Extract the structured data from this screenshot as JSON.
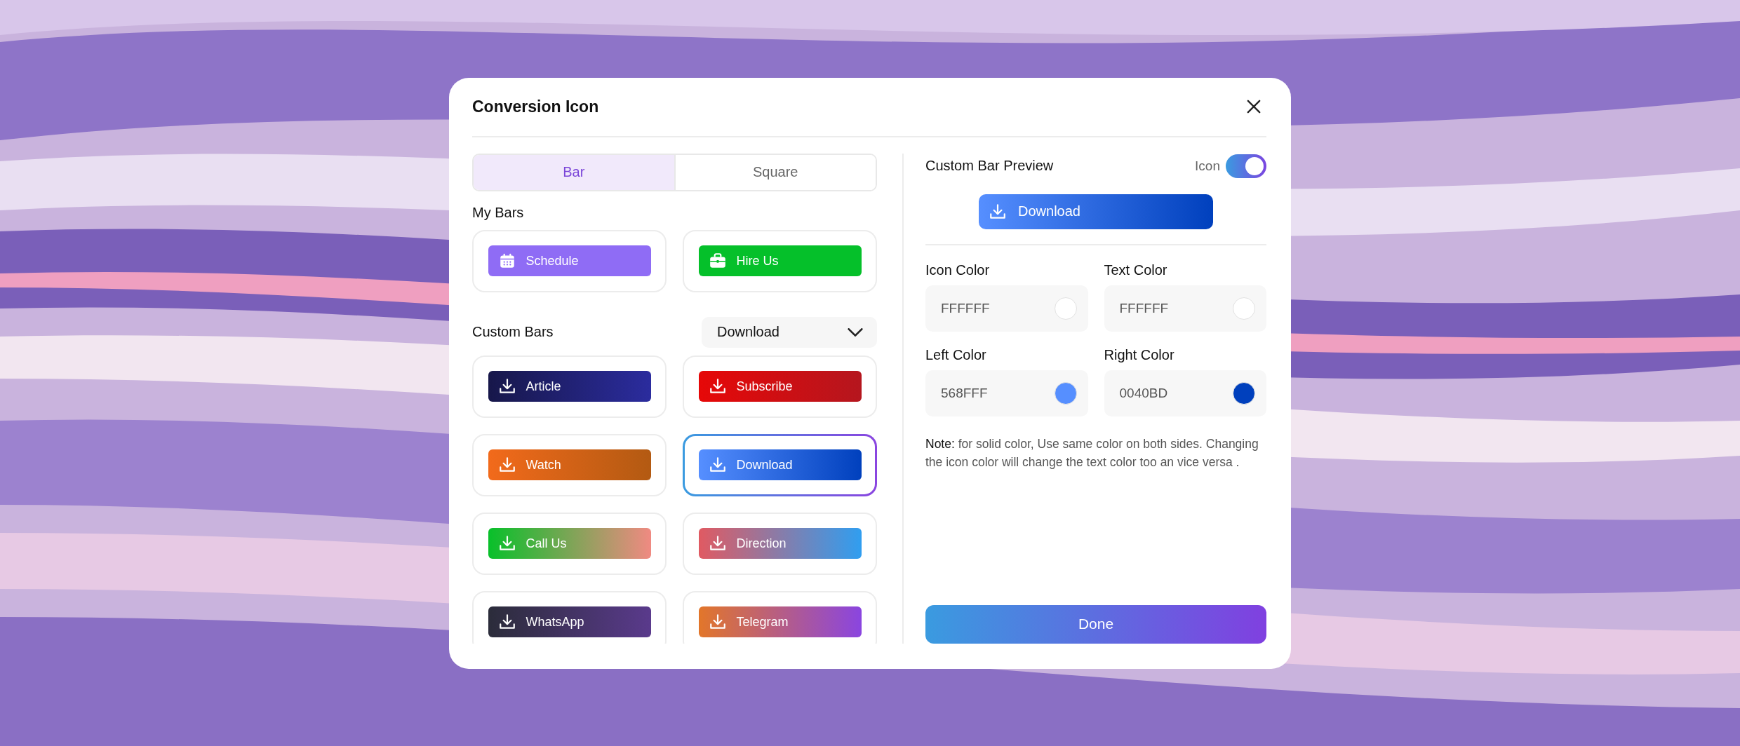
{
  "dialog": {
    "title": "Conversion Icon"
  },
  "tabs": [
    {
      "label": "Bar",
      "selected": true
    },
    {
      "label": "Square",
      "selected": false
    }
  ],
  "my_bars": {
    "heading": "My Bars",
    "items": [
      {
        "label": "Schedule",
        "kind": "calendar",
        "gradient": [
          {
            "color": "#8f6cf5"
          },
          {
            "color": "#8f6cf5"
          }
        ],
        "selected": false
      },
      {
        "label": "Hire Us",
        "kind": "briefcase",
        "gradient": [
          {
            "color": "#05c02a"
          },
          {
            "color": "#05c02a"
          }
        ],
        "selected": false
      }
    ]
  },
  "custom_bars": {
    "heading": "Custom Bars",
    "dropdown": "Download",
    "items": [
      {
        "label": "Article",
        "kind": "download",
        "gradient": [
          {
            "color": "#17174a"
          },
          {
            "color": "#2b2c9e"
          }
        ],
        "selected": false
      },
      {
        "label": "Subscribe",
        "kind": "download",
        "gradient": [
          {
            "color": "#e60808"
          },
          {
            "color": "#b5161e"
          }
        ],
        "selected": false
      },
      {
        "label": "Watch",
        "kind": "download",
        "gradient": [
          {
            "color": "#f26a1b"
          },
          {
            "color": "#b35a12"
          }
        ],
        "selected": false
      },
      {
        "label": "Download",
        "kind": "download",
        "gradient": [
          {
            "color": "#568fff"
          },
          {
            "color": "#0040bd"
          }
        ],
        "selected": true
      },
      {
        "label": "Call Us",
        "kind": "download",
        "gradient": [
          {
            "color": "#08c02a"
          },
          {
            "color": "#f08a82"
          }
        ],
        "selected": false
      },
      {
        "label": "Direction",
        "kind": "download",
        "gradient": [
          {
            "color": "#e05a62"
          },
          {
            "color": "#309ef0"
          }
        ],
        "selected": false
      },
      {
        "label": "WhatsApp",
        "kind": "download",
        "gradient": [
          {
            "color": "#2b2c3a"
          },
          {
            "color": "#5a3a8c"
          }
        ],
        "selected": false
      },
      {
        "label": "Telegram",
        "kind": "download",
        "gradient": [
          {
            "color": "#e2762a"
          },
          {
            "color": "#8a45e0"
          }
        ],
        "selected": false
      }
    ]
  },
  "preview": {
    "heading": "Custom Bar Preview",
    "toggle_label": "Icon",
    "icon_on": true,
    "bar": {
      "label": "Download",
      "kind": "download",
      "gradient": [
        {
          "color": "#568fff"
        },
        {
          "color": "#0040bd"
        }
      ]
    }
  },
  "fields": [
    {
      "label": "Icon Color",
      "value": "FFFFFF",
      "color": "#ffffff"
    },
    {
      "label": "Text Color",
      "value": "FFFFFF",
      "color": "#ffffff"
    },
    {
      "label": "Left Color",
      "value": "568FFF",
      "color": "#568fff"
    },
    {
      "label": "Right Color",
      "value": "0040BD",
      "color": "#0040bd"
    }
  ],
  "note": "**Note:** for solid color, Use same color on both sides. Changing the icon color will change the text color too an vice versa .",
  "done_button": "Done"
}
